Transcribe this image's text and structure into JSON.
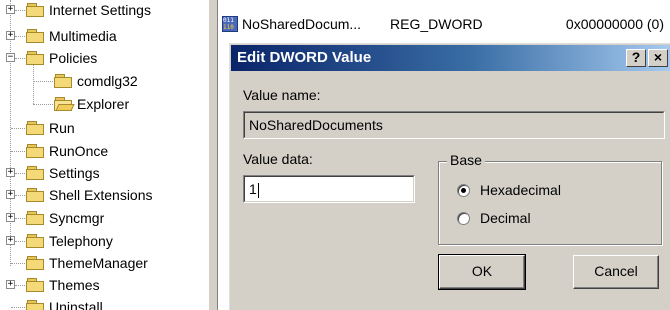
{
  "tree": {
    "items": [
      {
        "label": "Internet Settings",
        "expander": "+"
      },
      {
        "label": "Multimedia",
        "expander": "+"
      },
      {
        "label": "Policies",
        "expander": "−"
      },
      {
        "label": "comdlg32",
        "expander": ""
      },
      {
        "label": "Explorer",
        "expander": ""
      },
      {
        "label": "Run",
        "expander": ""
      },
      {
        "label": "RunOnce",
        "expander": ""
      },
      {
        "label": "Settings",
        "expander": "+"
      },
      {
        "label": "Shell Extensions",
        "expander": "+"
      },
      {
        "label": "Syncmgr",
        "expander": "+"
      },
      {
        "label": "Telephony",
        "expander": "+"
      },
      {
        "label": "ThemeManager",
        "expander": ""
      },
      {
        "label": "Themes",
        "expander": "+"
      },
      {
        "label": "Uninstall",
        "expander": ""
      }
    ]
  },
  "list": {
    "entry_name": "NoSharedDocum...",
    "entry_type": "REG_DWORD",
    "entry_data": "0x00000000 (0)"
  },
  "dialog": {
    "title": "Edit DWORD Value",
    "help_label": "?",
    "close_label": "×",
    "value_name_label": "Value name:",
    "value_name": "NoSharedDocuments",
    "value_data_label": "Value data:",
    "value_data": "1",
    "base_label": "Base",
    "hex_label": "Hexadecimal",
    "dec_label": "Decimal",
    "base_selected": "Hexadecimal",
    "ok_label": "OK",
    "cancel_label": "Cancel"
  },
  "colors": {
    "title_gradient_start": "#0a246a",
    "title_gradient_end": "#a6caf0",
    "dialog_face": "#d4d0c8",
    "folder_yellow": "#f4d978"
  }
}
